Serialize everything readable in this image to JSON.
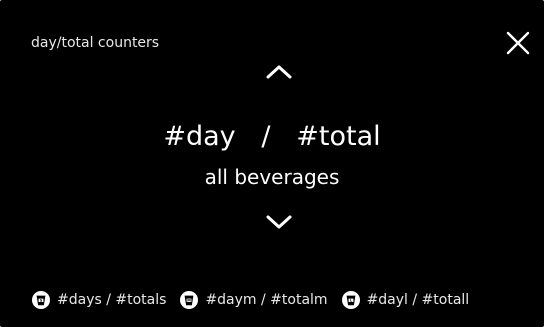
{
  "screen": {
    "title": "day/total counters"
  },
  "counter": {
    "day": "#day",
    "separator": "/",
    "total": "#total",
    "category": "all beverages"
  },
  "icons": {
    "close": "close-icon",
    "up": "chevron-up-icon",
    "down": "chevron-down-icon",
    "cup": "cup-icon"
  },
  "categories": [
    {
      "label": "#days / #totals"
    },
    {
      "label": "#daym / #totalm"
    },
    {
      "label": "#dayl / #totall"
    }
  ],
  "colors": {
    "background": "#000000",
    "foreground": "#ffffff"
  }
}
